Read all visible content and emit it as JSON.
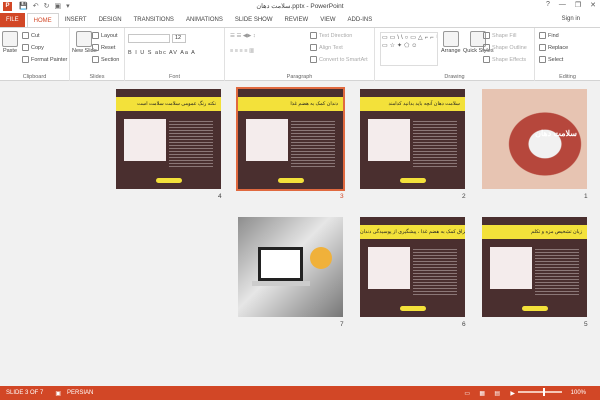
{
  "window": {
    "title": "سلامت دهان.pptx - PowerPoint",
    "app_icon": "P",
    "controls": [
      "?",
      "—",
      "❐",
      "✕"
    ]
  },
  "quick_access": [
    "💾",
    "↶",
    "↻",
    "▣",
    "▾"
  ],
  "tabs": [
    "FILE",
    "HOME",
    "INSERT",
    "DESIGN",
    "TRANSITIONS",
    "ANIMATIONS",
    "SLIDE SHOW",
    "REVIEW",
    "VIEW",
    "ADD-INS"
  ],
  "signin": "Sign in",
  "ribbon": {
    "clipboard": {
      "label": "Clipboard",
      "paste": "Paste",
      "cut": "Cut",
      "copy": "Copy",
      "format_painter": "Format Painter"
    },
    "slides": {
      "label": "Slides",
      "new_slide": "New Slide",
      "layout": "Layout",
      "reset": "Reset",
      "section": "Section"
    },
    "font": {
      "label": "Font",
      "size": "12",
      "glyphs": "B I U S abc AV Aa A"
    },
    "paragraph": {
      "label": "Paragraph",
      "text_direction": "Text Direction",
      "align_text": "Align Text",
      "convert": "Convert to SmartArt"
    },
    "drawing": {
      "label": "Drawing",
      "shapes_preview": "▭▭\\\\○▭△⌐⌐↳⇨☆{}▭☆✦⬠☺",
      "arrange": "Arrange",
      "quick_styles": "Quick Styles",
      "shape_fill": "Shape Fill",
      "shape_outline": "Shape Outline",
      "shape_effects": "Shape Effects"
    },
    "editing": {
      "label": "Editing",
      "find": "Find",
      "replace": "Replace",
      "select": "Select"
    }
  },
  "slides": [
    {
      "num": "1",
      "title": "",
      "lips_text": "سلامت دهان"
    },
    {
      "num": "2",
      "title": "سلامت دهان آنچه باید بدانید کدامند"
    },
    {
      "num": "3",
      "title": "دندان کمک به هضم غذا"
    },
    {
      "num": "4",
      "title": "نکته رنگ عمومی سلامت سلامت است"
    },
    {
      "num": "5",
      "title": "زبان تشخیص مزه و تکلم"
    },
    {
      "num": "6",
      "title": "غدد بزاق کمک به هضم غذا ، پیشگیری از پوسیدگی دندان"
    },
    {
      "num": "7",
      "title": ""
    }
  ],
  "status": {
    "slide_info": "SLIDE 3 OF 7",
    "language": "PERSIAN",
    "zoom": "100%"
  },
  "colors": {
    "accent": "#d24726",
    "slide_bg": "#4a2f2f",
    "slide_title": "#f3e13a"
  }
}
